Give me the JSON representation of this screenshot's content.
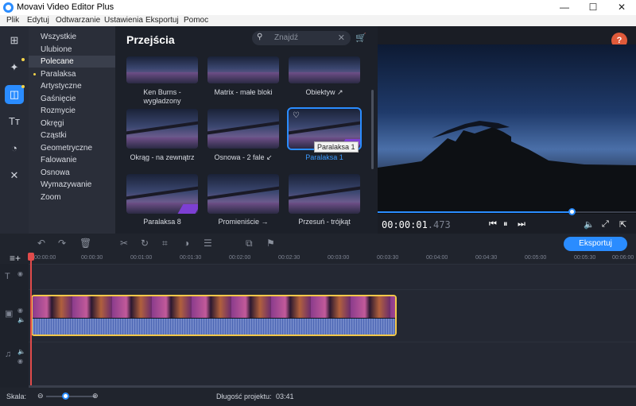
{
  "window": {
    "title": "Movavi Video Editor Plus",
    "minimize": "—",
    "maximize": "☐",
    "close": "✕"
  },
  "menu": [
    "Plik",
    "Edytuj",
    "Odtwarzanie",
    "Ustawienia",
    "Eksportuj",
    "Pomoc"
  ],
  "categories": [
    {
      "label": "Wszystkie"
    },
    {
      "label": "Ulubione"
    },
    {
      "label": "Polecane",
      "selected": true
    },
    {
      "label": "Paralaksa",
      "new": true
    },
    {
      "label": "Artystyczne"
    },
    {
      "label": "Gaśnięcie"
    },
    {
      "label": "Rozmycie"
    },
    {
      "label": "Okręgi"
    },
    {
      "label": "Cząstki"
    },
    {
      "label": "Geometryczne"
    },
    {
      "label": "Falowanie"
    },
    {
      "label": "Osnowa"
    },
    {
      "label": "Wymazywanie"
    },
    {
      "label": "Zoom"
    }
  ],
  "panel": {
    "title": "Przejścia",
    "search_placeholder": "Znajdź"
  },
  "transitions": [
    {
      "label": "Ken Burns -\nwygładzony"
    },
    {
      "label": "Matrix - małe bloki"
    },
    {
      "label": "Obiektyw ↗"
    },
    {
      "label": "Okrąg - na zewnątrz"
    },
    {
      "label": "Osnowa - 2 fale ↙"
    },
    {
      "label": "Paralaksa 1",
      "selected": true
    },
    {
      "label": "Paralaksa 8"
    },
    {
      "label": "Promieniście →"
    },
    {
      "label": "Przesuń - trójkąt"
    }
  ],
  "tooltip": "Paralaksa 1",
  "preview": {
    "time_main": "00:00:01",
    "time_ms": ".473",
    "help": "?"
  },
  "toolbar": {
    "export_label": "Eksportuj"
  },
  "ruler": [
    "00:00:00",
    "00:00:30",
    "00:01:00",
    "00:01:30",
    "00:02:00",
    "00:02:30",
    "00:03:00",
    "00:03:30",
    "00:04:00",
    "00:04:30",
    "00:05:00",
    "00:05:30",
    "00:06:00"
  ],
  "status": {
    "scale_label": "Skala:",
    "duration_label": "Długość projektu:",
    "duration_value": "03:41"
  },
  "colors": {
    "accent": "#2a8cff",
    "clip_border": "#f2c84a",
    "playhead": "#e14b4b"
  }
}
